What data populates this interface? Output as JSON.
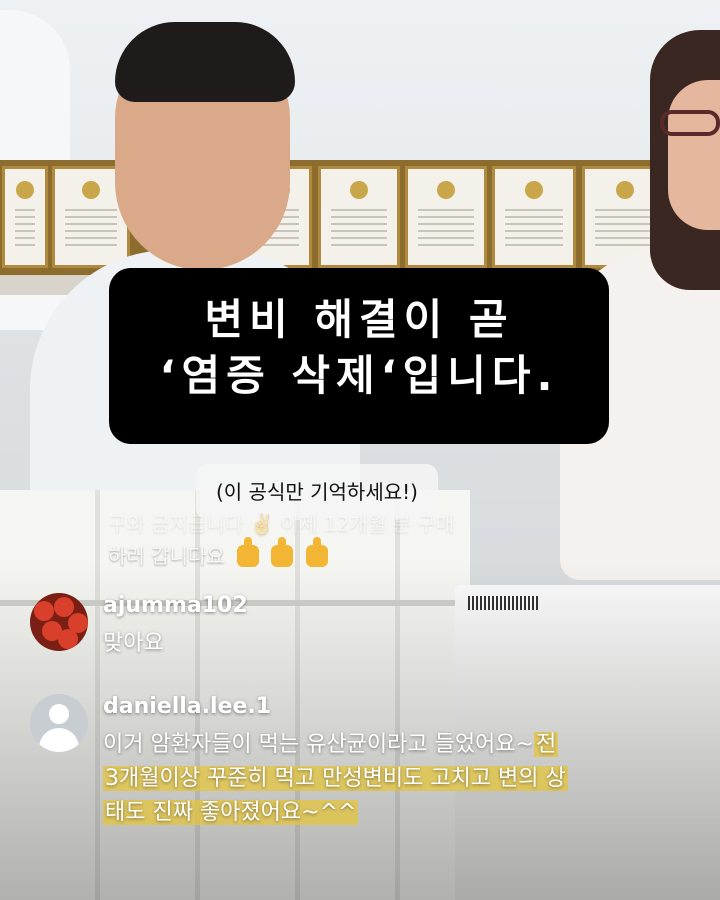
{
  "headline": {
    "line1": "변비 해결이 곧",
    "line2": "‘염증 삭제‘입니다."
  },
  "sub_caption": "(이 공식만 기억하세요!)",
  "faded_comment": {
    "line1": "구와 금지급니다 ✌️ 이제 12개월 분 구매",
    "line2": "하러 갑니다요"
  },
  "comments": [
    {
      "username": "ajumma102",
      "avatar": "tomatoes-photo",
      "text": "맞아요"
    },
    {
      "username": "daniella.lee.1",
      "avatar": "default-person-icon",
      "text_plain": "이거 암환자들이 먹는 유산균이라고 들었어요~",
      "text_highlight": "전 3개월이상 꾸준히 먹고 만성변비도 고치고 변의 상태도 진짜 좋아졌어요~^^"
    }
  ],
  "colors": {
    "headline_bg": "#000000",
    "headline_text": "#ffffff",
    "highlight": "#e4c43c",
    "comment_text": "#ffffff"
  }
}
